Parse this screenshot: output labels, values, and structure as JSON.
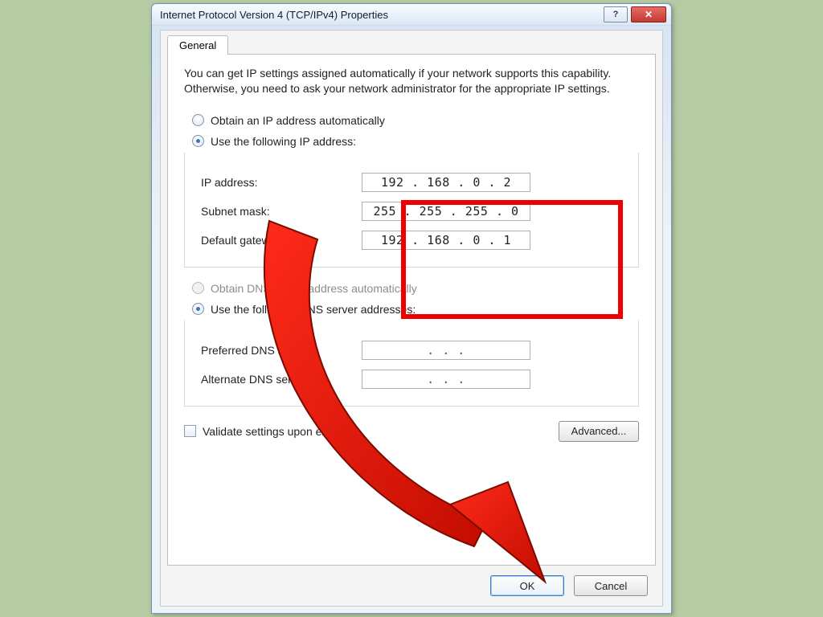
{
  "window": {
    "title": "Internet Protocol Version 4 (TCP/IPv4) Properties"
  },
  "tabs": {
    "general": "General"
  },
  "intro": "You can get IP settings assigned automatically if your network supports this capability. Otherwise, you need to ask your network administrator for the appropriate IP settings.",
  "ip": {
    "obtain_auto_label": "Obtain an IP address automatically",
    "use_following_label": "Use the following IP address:",
    "ip_label": "IP address:",
    "ip_value": "192 . 168 .  0  .  2",
    "subnet_label": "Subnet mask:",
    "subnet_value": "255 . 255 . 255 .  0",
    "gateway_label": "Default gateway:",
    "gateway_value": "192 . 168 .  0  .  1"
  },
  "dns": {
    "obtain_auto_label": "Obtain DNS server address automatically",
    "use_following_label": "Use the following DNS server addresses:",
    "preferred_label": "Preferred DNS server:",
    "preferred_value": ".       .       .",
    "alternate_label": "Alternate DNS server:",
    "alternate_value": ".       .       ."
  },
  "validate_label": "Validate settings upon exit",
  "buttons": {
    "advanced": "Advanced...",
    "ok": "OK",
    "cancel": "Cancel"
  }
}
